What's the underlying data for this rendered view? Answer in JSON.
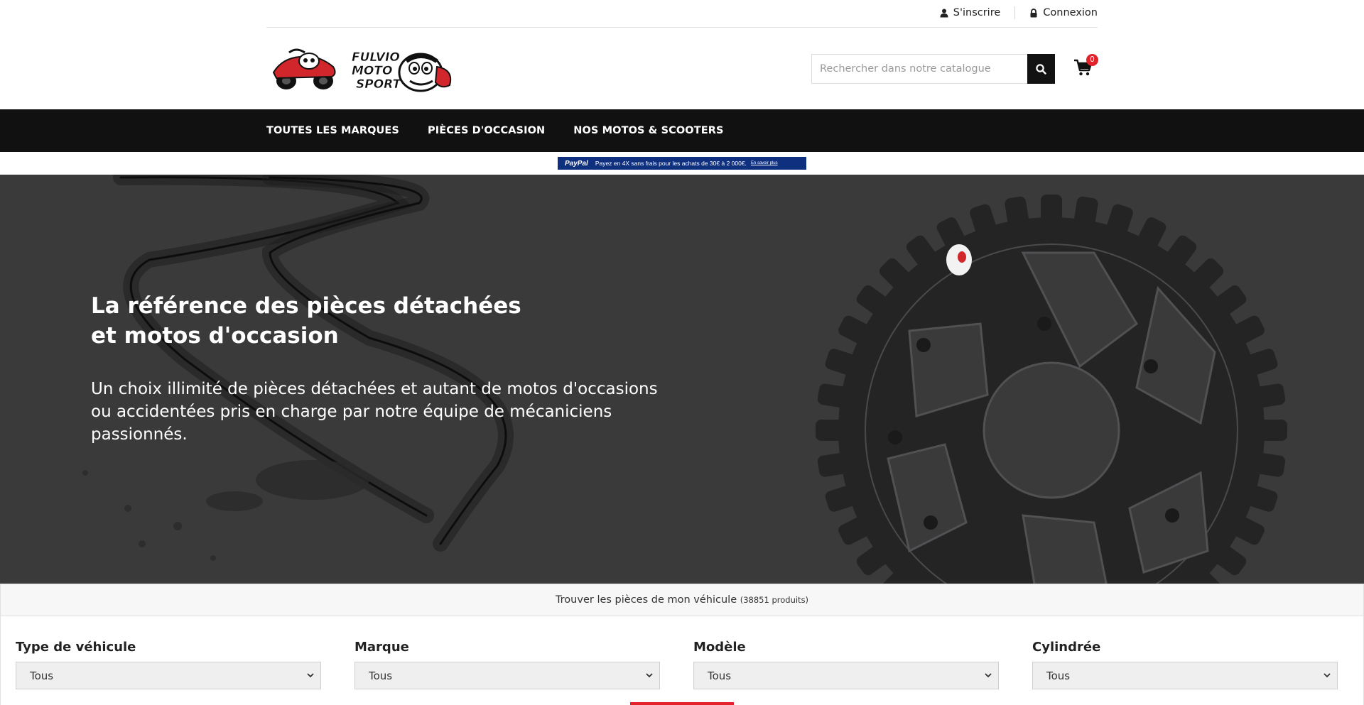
{
  "topbar": {
    "register_label": "S'inscrire",
    "login_label": "Connexion"
  },
  "header": {
    "logo_text": "FULVIO MOTO SPORT",
    "search_placeholder": "Rechercher dans notre catalogue",
    "cart_count": "0"
  },
  "nav": {
    "items": [
      {
        "label": "TOUTES LES MARQUES"
      },
      {
        "label": "PIÈCES D'OCCASION"
      },
      {
        "label": "NOS MOTOS & SCOOTERS"
      }
    ]
  },
  "paypal_banner": {
    "brand": "PayPal",
    "text": "Payez en 4X sans frais pour les achats de 30€ à 2 000€.",
    "link": "En savoir plus"
  },
  "hero": {
    "title": "La référence des pièces détachées et motos d'occasion",
    "subtitle": "Un choix illimité de pièces détachées et autant de motos d'occasions ou accidentées pris en charge par notre équipe de mécaniciens passionnés."
  },
  "finder": {
    "heading": "Trouver les pièces de mon véhicule",
    "count": "(38851 produits)",
    "filters": [
      {
        "label": "Type de véhicule",
        "value": "Tous"
      },
      {
        "label": "Marque",
        "value": "Tous"
      },
      {
        "label": "Modèle",
        "value": "Tous"
      },
      {
        "label": "Cylindrée",
        "value": "Tous"
      }
    ]
  },
  "colors": {
    "nav_bg": "#111111",
    "hero_bg": "#3a3a3b",
    "accent_red": "#e3222b",
    "paypal_blue": "#0f2f7f"
  }
}
